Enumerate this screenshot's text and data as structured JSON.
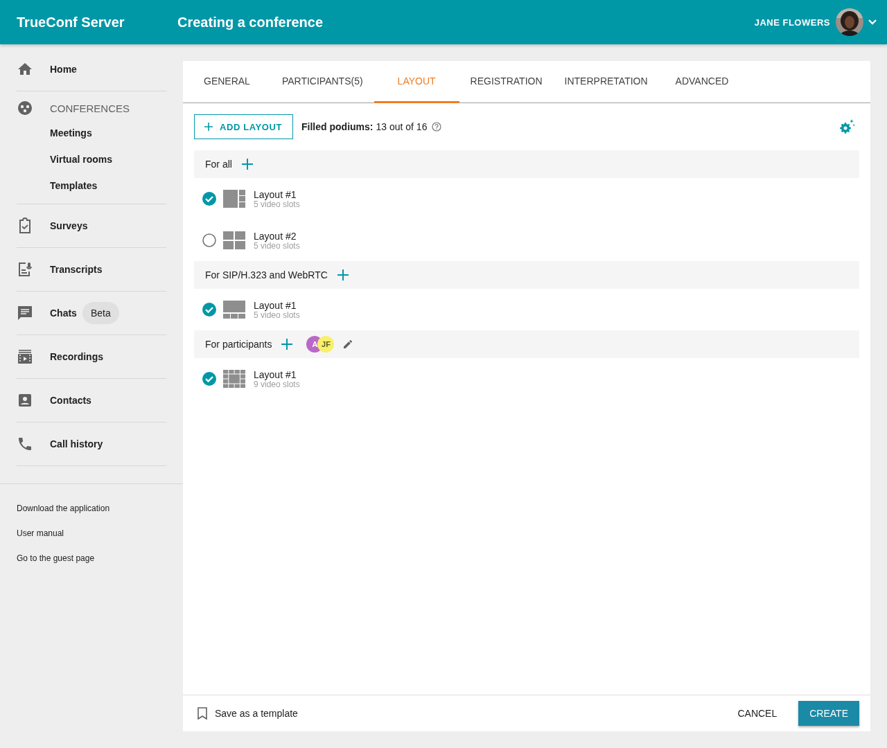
{
  "header": {
    "app_name": "TrueConf Server",
    "page_title": "Creating a conference",
    "user_name": "JANE FLOWERS"
  },
  "sidebar": {
    "items": [
      {
        "label": "Home",
        "kind": "link"
      },
      {
        "label": "CONFERENCES",
        "kind": "group",
        "children": [
          {
            "label": "Meetings"
          },
          {
            "label": "Virtual rooms"
          },
          {
            "label": "Templates"
          }
        ]
      },
      {
        "label": "Surveys",
        "kind": "link"
      },
      {
        "label": "Transcripts",
        "kind": "link"
      },
      {
        "label": "Chats",
        "kind": "link",
        "badge": "Beta"
      },
      {
        "label": "Recordings",
        "kind": "link"
      },
      {
        "label": "Contacts",
        "kind": "link"
      },
      {
        "label": "Call history",
        "kind": "link"
      }
    ],
    "links": [
      "Download the application",
      "User manual",
      "Go to the guest page"
    ]
  },
  "tabs": [
    {
      "label": "GENERAL",
      "selected": false
    },
    {
      "label": "PARTICIPANTS(5)",
      "selected": false
    },
    {
      "label": "LAYOUT",
      "selected": true
    },
    {
      "label": "REGISTRATION",
      "selected": false
    },
    {
      "label": "INTERPRETATION",
      "selected": false
    },
    {
      "label": "ADVANCED",
      "selected": false
    }
  ],
  "toolbar": {
    "add_button": "ADD LAYOUT",
    "podiums_label": "Filled podiums:",
    "podiums_value": "13 out of 16"
  },
  "groups": [
    {
      "title": "For all",
      "layouts": [
        {
          "name": "Layout #1",
          "slots": "5 video slots",
          "kind": "side",
          "selected": true
        },
        {
          "name": "Layout #2",
          "slots": "5 video slots",
          "kind": "quad",
          "selected": false
        }
      ]
    },
    {
      "title": "For SIP/H.323 and WebRTC",
      "layouts": [
        {
          "name": "Layout #1",
          "slots": "5 video slots",
          "kind": "strip",
          "selected": true
        }
      ]
    },
    {
      "title": "For participants",
      "participants": [
        {
          "initials": "A",
          "color": "#b968c7"
        },
        {
          "initials": "JF",
          "color": "#f8ef6c"
        }
      ],
      "layouts": [
        {
          "name": "Layout #1",
          "slots": "9 video slots",
          "kind": "grid",
          "selected": true
        }
      ]
    }
  ],
  "footer": {
    "save_template": "Save as a template",
    "cancel": "CANCEL",
    "create": "CREATE"
  }
}
